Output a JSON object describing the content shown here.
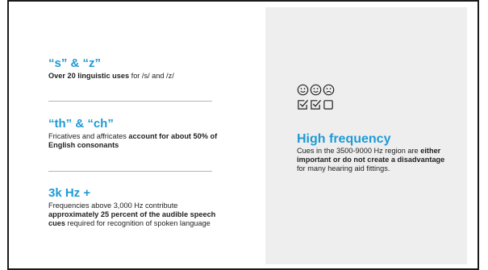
{
  "section1": {
    "heading": "“s” & “z”",
    "bold": "Over 20 linguistic uses",
    "rest": " for /s/ and /z/"
  },
  "section2": {
    "heading": "“th” & “ch”",
    "pre": "Fricatives and affricates ",
    "bold": "account for about 50% of English consonants"
  },
  "section3": {
    "heading": "3k Hz +",
    "pre": "Frequencies above 3,000 Hz contribute ",
    "bold": "approximately 25 percent of the audible speech cues",
    "post": " required for recognition of spoken language"
  },
  "panel": {
    "heading": "High frequency",
    "pre": "Cues in the 3500-9000 Hz region are ",
    "bold": "either important or do not create a disadvantage",
    "post": " for many hearing aid fittings."
  },
  "icons": [
    "smiley-happy-icon",
    "smiley-happy-icon",
    "smiley-sad-icon",
    "checkbox-checked-icon",
    "checkbox-checked-icon",
    "checkbox-empty-icon"
  ],
  "colors": {
    "accent": "#1f9ad6",
    "panel_bg": "#eeeeee"
  }
}
